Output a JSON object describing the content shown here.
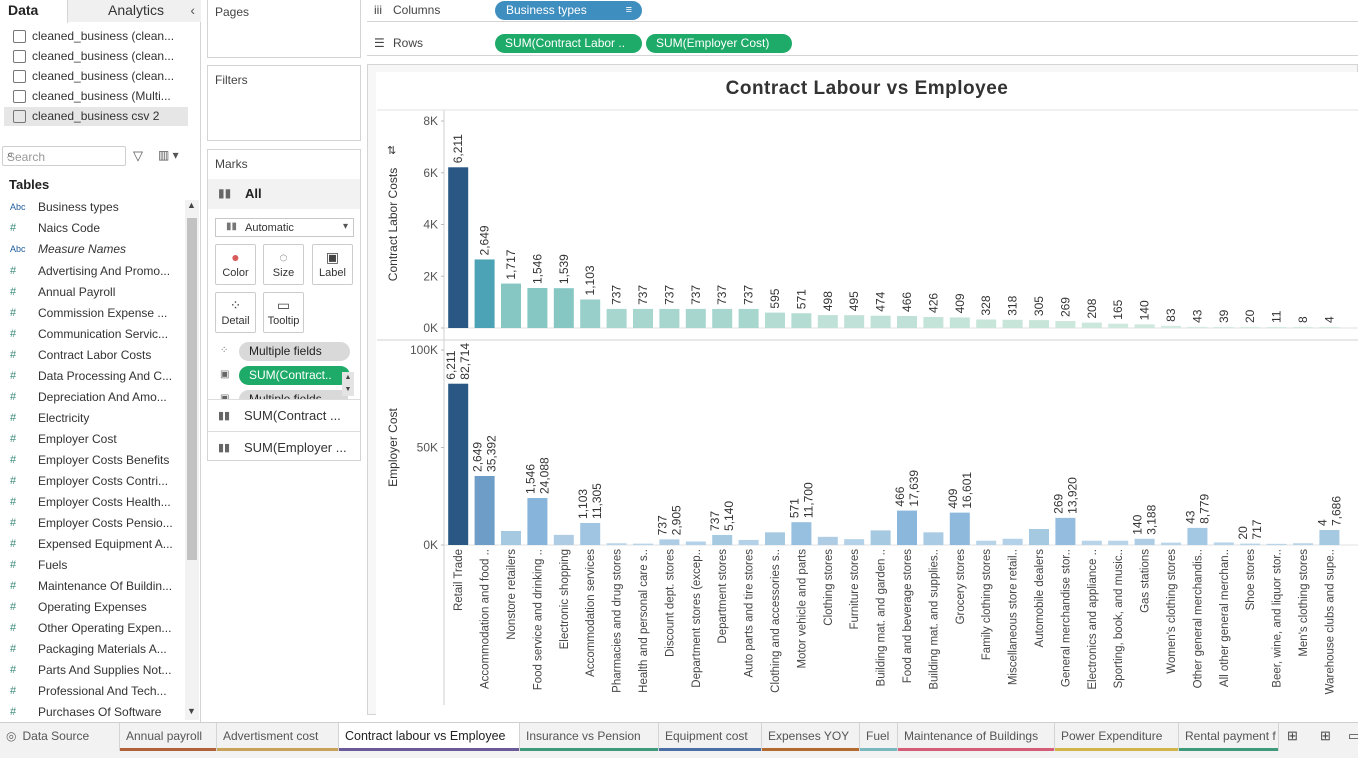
{
  "data_pane": {
    "tab_data": "Data",
    "tab_analytics": "Analytics",
    "datasources": [
      "cleaned_business (clean...",
      "cleaned_business (clean...",
      "cleaned_business (clean...",
      "cleaned_business (Multi...",
      "cleaned_business csv 2"
    ],
    "search_placeholder": "Search",
    "tables_heading": "Tables",
    "fields": [
      {
        "type": "Abc",
        "name": "Business types"
      },
      {
        "type": "#",
        "name": "Naics Code"
      },
      {
        "type": "Abc",
        "name": "Measure Names"
      },
      {
        "type": "#",
        "name": "Advertising And Promo..."
      },
      {
        "type": "#",
        "name": "Annual Payroll"
      },
      {
        "type": "#",
        "name": "Commission Expense ..."
      },
      {
        "type": "#",
        "name": "Communication Servic..."
      },
      {
        "type": "#",
        "name": "Contract Labor Costs"
      },
      {
        "type": "#",
        "name": "Data Processing And C..."
      },
      {
        "type": "#",
        "name": "Depreciation And Amo..."
      },
      {
        "type": "#",
        "name": "Electricity"
      },
      {
        "type": "#",
        "name": "Employer Cost"
      },
      {
        "type": "#",
        "name": "Employer Costs Benefits"
      },
      {
        "type": "#",
        "name": "Employer Costs Contri..."
      },
      {
        "type": "#",
        "name": "Employer Costs Health..."
      },
      {
        "type": "#",
        "name": "Employer Costs Pensio..."
      },
      {
        "type": "#",
        "name": "Expensed Equipment A..."
      },
      {
        "type": "#",
        "name": "Fuels"
      },
      {
        "type": "#",
        "name": "Maintenance Of Buildin..."
      },
      {
        "type": "#",
        "name": "Operating Expenses"
      },
      {
        "type": "#",
        "name": "Other Operating Expen..."
      },
      {
        "type": "#",
        "name": "Packaging Materials A..."
      },
      {
        "type": "#",
        "name": "Parts And Supplies Not..."
      },
      {
        "type": "#",
        "name": "Professional And Tech..."
      },
      {
        "type": "#",
        "name": "Purchases Of Software"
      }
    ]
  },
  "shelves": {
    "pages": "Pages",
    "filters": "Filters",
    "columns": "Columns",
    "rows": "Rows",
    "column_pill": "Business types",
    "row_pills": [
      "SUM(Contract Labor ..",
      "SUM(Employer Cost)"
    ]
  },
  "marks": {
    "title": "Marks",
    "all": "All",
    "mark_type": "Automatic",
    "buttons": [
      "Color",
      "Size",
      "Label",
      "Detail",
      "Tooltip"
    ],
    "pills": [
      "Multiple fields",
      "SUM(Contract..",
      "Multiple fields"
    ],
    "sections": [
      "SUM(Contract ...",
      "SUM(Employer ..."
    ]
  },
  "chart_data": {
    "type": "bar",
    "title": "Contract  Labour vs Employee",
    "categories": [
      "Retail Trade",
      "Accommodation and food ..",
      "Nonstore retailers",
      "Food service and drinking ..",
      "Electronic shopping",
      "Accommodation services",
      "Pharmacies and drug stores",
      "Health and personal care s..",
      "Discount dept. stores",
      "Department stores (excep..",
      "Department stores",
      "Auto parts and tire stores",
      "Clothing and accessories s..",
      "Motor vehicle and parts",
      "Clothing stores",
      "Furniture stores",
      "Building mat. and garden ..",
      "Food and beverage stores",
      "Building mat. and supplies..",
      "Grocery stores",
      "Family clothing stores",
      "Miscellaneous store retail..",
      "Automobile dealers",
      "General merchandise stor..",
      "Electronics and appliance ..",
      "Sporting, book, and music..",
      "Gas stations",
      "Women's clothing stores",
      "Other general merchandis..",
      "All other general merchan..",
      "Shoe stores",
      "Beer, wine, and liquor stor..",
      "Men's clothing stores",
      "Warehouse clubs and supe.."
    ],
    "series": [
      {
        "name": "Contract Labor Costs",
        "ylabel": "Contract Labor Costs",
        "ticks": [
          "8K",
          "6K",
          "4K",
          "2K",
          "0K"
        ],
        "ylim": [
          0,
          8000
        ],
        "values": [
          6211,
          2649,
          1717,
          1546,
          1539,
          1103,
          737,
          737,
          737,
          737,
          737,
          737,
          595,
          571,
          498,
          495,
          474,
          466,
          426,
          409,
          328,
          318,
          305,
          269,
          208,
          165,
          140,
          83,
          43,
          39,
          20,
          11,
          8,
          4
        ],
        "labels": [
          "6,211",
          "2,649",
          "1,717",
          "1,546",
          "1,539",
          "1,103",
          "737",
          "737",
          "737",
          "737",
          "737",
          "737",
          "595",
          "571",
          "498",
          "495",
          "474",
          "466",
          "426",
          "409",
          "328",
          "318",
          "305",
          "269",
          "208",
          "165",
          "140",
          "83",
          "43",
          "39",
          "20",
          "11",
          "8",
          "4"
        ]
      },
      {
        "name": "Employer Cost",
        "ylabel": "Employer Cost",
        "ticks": [
          "100K",
          "50K",
          "0K"
        ],
        "ylim": [
          0,
          100000
        ],
        "values": [
          82714,
          35392,
          7200,
          24088,
          5200,
          11305,
          900,
          700,
          2905,
          1800,
          5140,
          2600,
          6500,
          11700,
          4200,
          3000,
          7500,
          17639,
          6500,
          16601,
          2200,
          3200,
          8200,
          13920,
          2200,
          2200,
          3188,
          1200,
          8779,
          1300,
          717,
          600,
          900,
          7686
        ],
        "labels": [
          "6,211\n82,714",
          "2,649\n35,392",
          "",
          "1,546\n24,088",
          "",
          "1,103\n11,305",
          "",
          "",
          "737\n2,905",
          "",
          "737\n5,140",
          "",
          "",
          "571\n11,700",
          "",
          "",
          "",
          "466\n17,639",
          "",
          "409\n16,601",
          "",
          "",
          "",
          "269\n13,920",
          "",
          "",
          "140\n3,188",
          "",
          "43\n8,779",
          "",
          "20\n717",
          "",
          "",
          "4\n7,686"
        ]
      }
    ],
    "bar_colors_top": [
      "#2a5783",
      "#4ba3b5",
      "#86c7c3",
      "#86c7c3",
      "#86c7c3",
      "#98cfca",
      "#a7d6cf",
      "#a7d6cf",
      "#a7d6cf",
      "#a7d6cf",
      "#a7d6cf",
      "#a7d6cf",
      "#b5dcd3",
      "#b5dcd3",
      "#bfe1d7",
      "#bfe1d7",
      "#bfe1d7",
      "#bfe1d7",
      "#c4e3d9",
      "#c4e3d9",
      "#c8e5da",
      "#c8e5da",
      "#c8e5da",
      "#cce7dc",
      "#cce7dc",
      "#cfe8dd",
      "#cfe8dd",
      "#d2eadf",
      "#d2eadf",
      "#d2eadf",
      "#d4ebe0",
      "#d4ebe0",
      "#d4ebe0",
      "#d4ebe0"
    ],
    "bar_colors_bottom": [
      "#2a5783",
      "#6e9ec8",
      "#a6c9e2",
      "#86b4da",
      "#aecde5",
      "#9fc5e3",
      "#b8d4e9",
      "#b8d4e9",
      "#aecde5",
      "#b3d1e8",
      "#a6c9e2",
      "#b3d1e8",
      "#a6c9e2",
      "#97bfe0",
      "#aecde5",
      "#b3d1e8",
      "#a6c9e2",
      "#8bb7dc",
      "#a9cbe4",
      "#8eb9dc",
      "#b8d4e9",
      "#b3d1e8",
      "#a6c9e2",
      "#93bcde",
      "#b8d4e9",
      "#b8d4e9",
      "#aecde5",
      "#b8d4e9",
      "#a3c8e3",
      "#b8d4e9",
      "#b8d4e9",
      "#b8d4e9",
      "#b8d4e9",
      "#a6c9e2"
    ]
  },
  "sheet_tabs": [
    {
      "label": "Data Source",
      "color": ""
    },
    {
      "label": "Annual payroll",
      "color": "#b0613a"
    },
    {
      "label": "Advertisment  cost",
      "color": "#c9a25a"
    },
    {
      "label": "Contract  labour vs Employee",
      "color": "#6a5a9a"
    },
    {
      "label": "Insurance  vs  Pension",
      "color": "#3e9a7a"
    },
    {
      "label": "Equipment cost",
      "color": "#4a6fa5"
    },
    {
      "label": "Expenses  YOY",
      "color": "#b36a2e"
    },
    {
      "label": "Fuel",
      "color": "#7ab8c0"
    },
    {
      "label": "Maintenance of Buildings",
      "color": "#d45d7a"
    },
    {
      "label": "Power  Expenditure",
      "color": "#d2b54a"
    },
    {
      "label": "Rental payment f",
      "color": "#3e9a7a"
    }
  ]
}
